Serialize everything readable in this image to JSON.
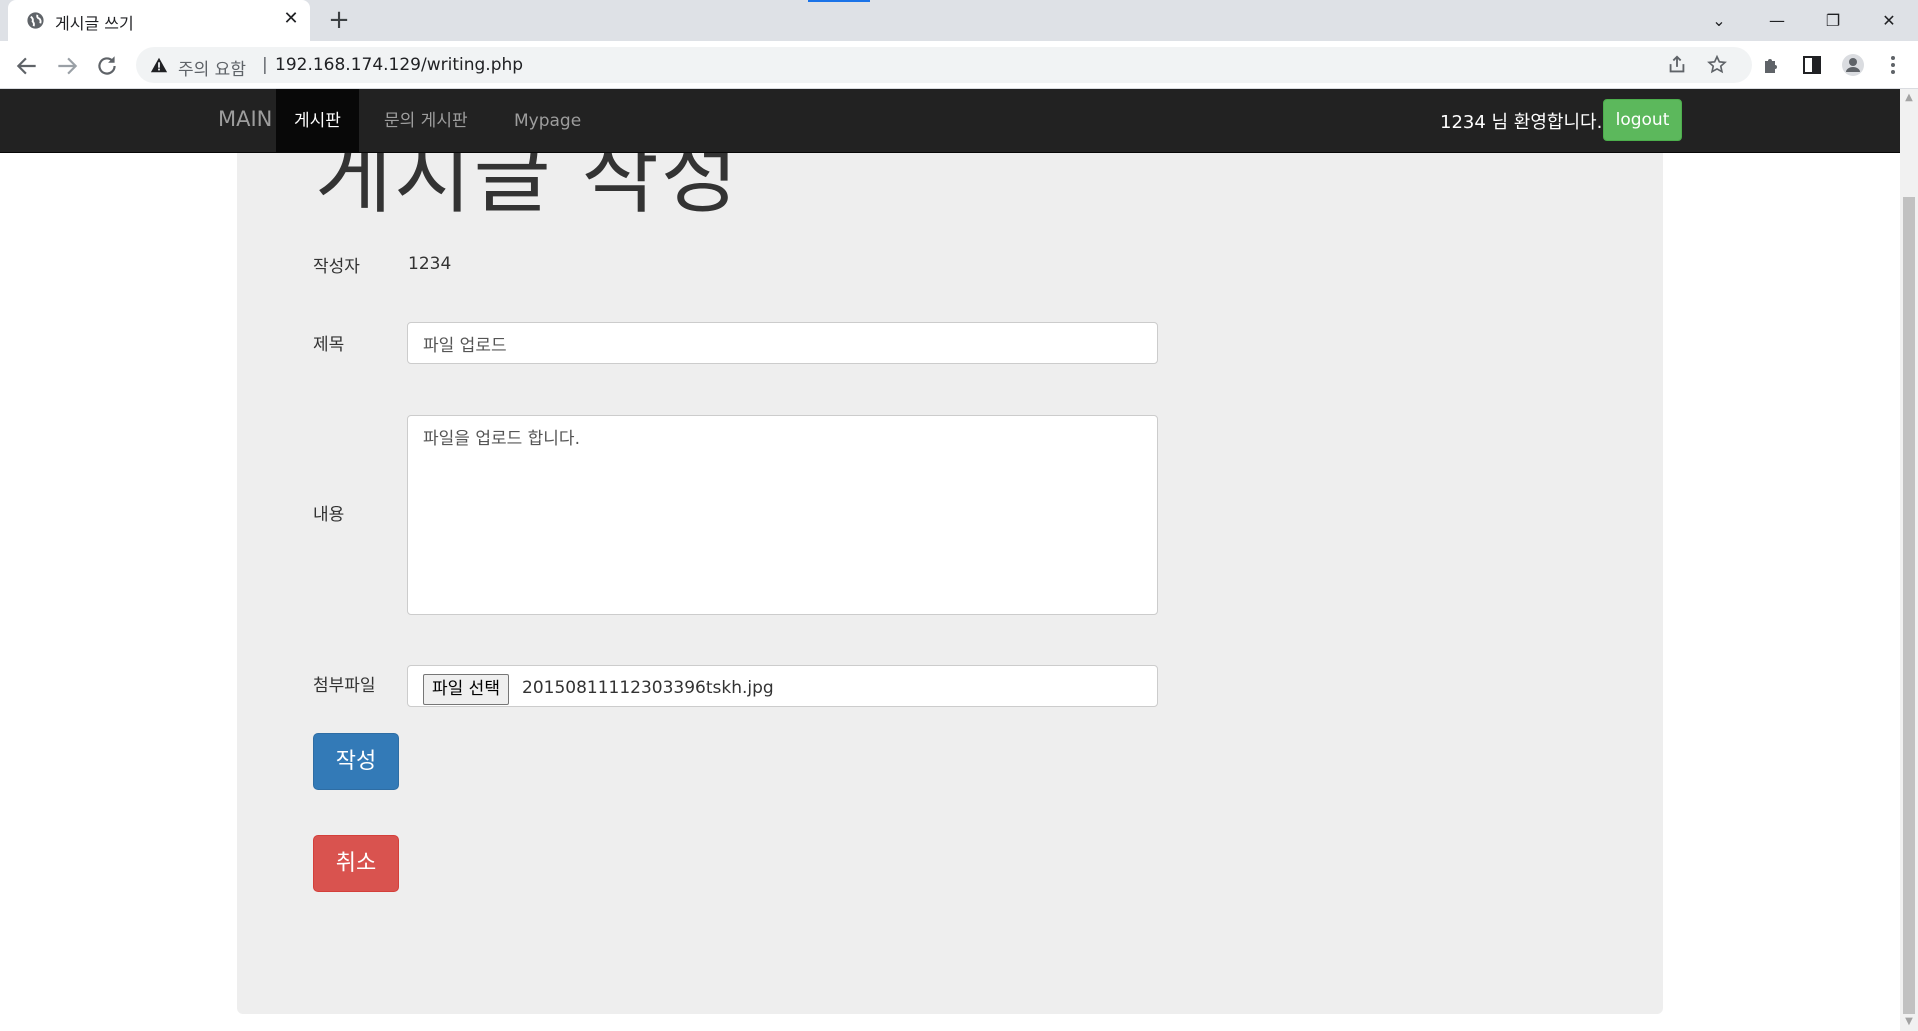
{
  "browser": {
    "tab_title": "게시글 쓰기",
    "tab_close": "✕",
    "new_tab": "+",
    "window": {
      "minimize": "—",
      "maximize": "❐",
      "close": "✕",
      "tab_search": "⌄"
    },
    "warning_text": "주의 요함",
    "url_separator": "|",
    "url": "192.168.174.129/writing.php"
  },
  "navbar": {
    "brand": "MAIN",
    "items": [
      {
        "label": "게시판",
        "active": true
      },
      {
        "label": "문의 게시판",
        "active": false
      },
      {
        "label": "Mypage",
        "active": false
      }
    ],
    "welcome": "1234 님 환영합니다.",
    "logout": "logout"
  },
  "form": {
    "heading": "게시글 작성",
    "author_label": "작성자",
    "author_value": "1234",
    "title_label": "제목",
    "title_value": "파일 업로드",
    "content_label": "내용",
    "content_value": "파일을 업로드 합니다.",
    "attachment_label": "첨부파일",
    "file_button": "파일 선택",
    "file_name": "20150811112303396tskh.jpg",
    "submit_button": "작성",
    "cancel_button": "취소"
  },
  "colors": {
    "navbar_bg": "#222222",
    "jumbotron_bg": "#eeeeee",
    "logout_green": "#5cb85c",
    "primary_blue": "#337ab7",
    "danger_red": "#d9534f"
  }
}
